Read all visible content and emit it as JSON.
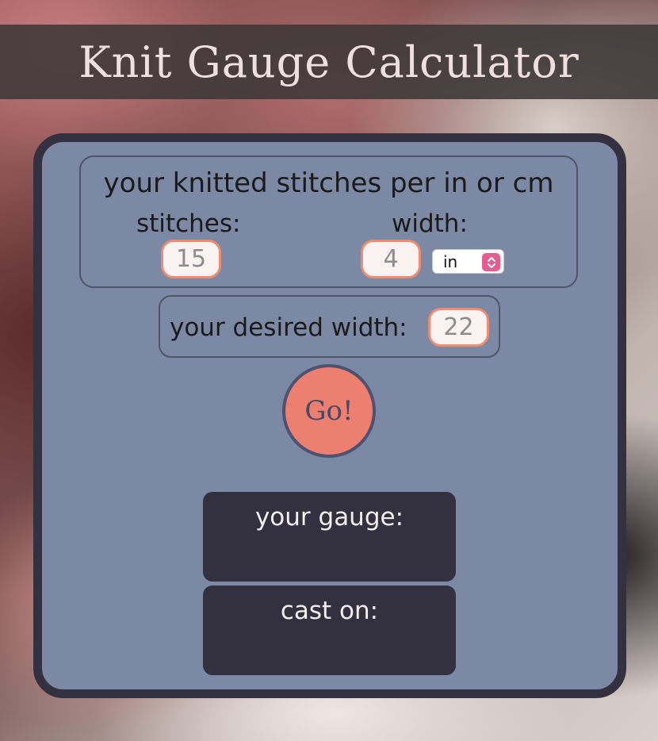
{
  "app": {
    "title": "Knit Gauge Calculator"
  },
  "gauge_section": {
    "heading": "your knitted stitches per in or cm",
    "stitches_label": "stitches:",
    "stitches_value": "15",
    "width_label": "width:",
    "width_value": "4",
    "unit_selected": "in"
  },
  "desired_section": {
    "label": "your desired width:",
    "value": "22"
  },
  "go_button": {
    "label": "Go!"
  },
  "results": {
    "gauge_label": "your gauge:",
    "gauge_value": "",
    "cast_on_label": "cast on:",
    "cast_on_value": ""
  },
  "colors": {
    "card_bg": "#7b89a5",
    "card_border": "#33313f",
    "input_border": "#ec8d72",
    "go_button": "#ec7f70",
    "select_accent": "#e45d93"
  },
  "icons": {
    "select_arrows": "chevron-up-down-icon"
  }
}
